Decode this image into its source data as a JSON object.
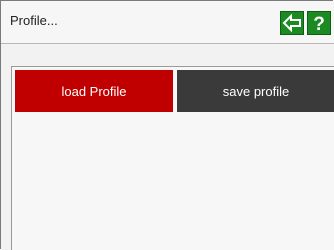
{
  "window": {
    "title": "Profile..."
  },
  "toolbar": {
    "back_icon": "back-arrow-icon",
    "help_icon": "question-mark-icon",
    "help_label": "?"
  },
  "actions": {
    "load_label": "load Profile",
    "save_label": "save profile"
  },
  "colors": {
    "accent_green": "#1b8a22",
    "load_red": "#c00000",
    "save_dark": "#3a3a3a"
  }
}
